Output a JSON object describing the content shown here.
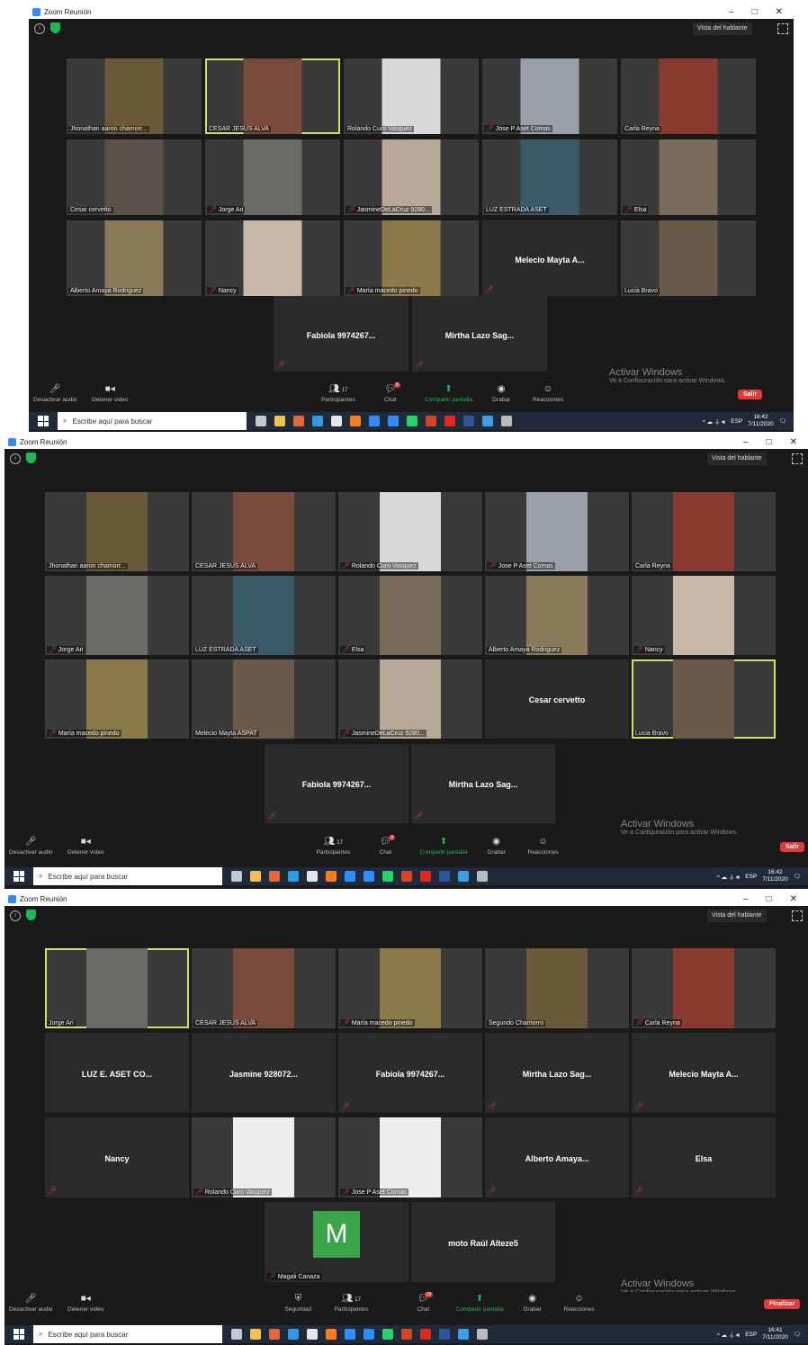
{
  "window": {
    "title": "Zoom Reunión",
    "min": "–",
    "max": "□",
    "close": "✕"
  },
  "top": {
    "speaker_view": "Vista del hablante",
    "info": "i"
  },
  "controls": {
    "mute": "Desactivar audio",
    "video": "Detener video",
    "security": "Seguridad",
    "participants": "Participantes",
    "participants_count": "17",
    "chat": "Chat",
    "chat_badge_1": "6",
    "chat_badge_3": "19",
    "share": "Compartir pantalla",
    "record": "Grabar",
    "reactions": "Reacciones",
    "leave": "Salir",
    "end": "Finalizar"
  },
  "activate": {
    "line1": "Activar Windows",
    "line2": "Ve a Configuración para activar Windows."
  },
  "taskbar": {
    "search": "Escribe aquí para buscar",
    "lang": "ESP",
    "time1": "16:42",
    "time3": "16:41",
    "date": "7/11/2020"
  },
  "shot1": {
    "tiles": [
      {
        "label": "Jhonathan aaron chamorr...",
        "muted": false,
        "video": true,
        "color": "#6b5a3a"
      },
      {
        "label": "CESAR JESUS ALVA",
        "muted": false,
        "video": true,
        "color": "#7a4a3a",
        "hl": true
      },
      {
        "label": "Rolando Curo Vasquez",
        "muted": false,
        "video": true,
        "color": "#d8d8d8"
      },
      {
        "label": "Jose P Aset Comas",
        "muted": true,
        "video": true,
        "color": "#9aa0a8"
      },
      {
        "label": "Carla Reyna",
        "muted": false,
        "video": true,
        "color": "#8a3a2e"
      },
      {
        "label": "Cesar cervetto",
        "muted": false,
        "video": true,
        "color": "#5a5248"
      },
      {
        "label": "Jorge  Ari",
        "muted": true,
        "video": true,
        "color": "#6a6a66"
      },
      {
        "label": "JasmineDeLaCruz 9280...",
        "muted": true,
        "video": true,
        "color": "#b8a898"
      },
      {
        "label": "LUZ ESTRADA ASET",
        "muted": false,
        "video": true,
        "color": "#3a5a6a"
      },
      {
        "label": "Elsa",
        "muted": true,
        "video": true,
        "color": "#7a6a5a"
      },
      {
        "label": "Alberto Amaya Rodriguez",
        "muted": false,
        "video": true,
        "color": "#8a7a5a"
      },
      {
        "label": "Nancy",
        "muted": true,
        "video": true,
        "color": "#c8b8a8"
      },
      {
        "label": "María macedo pinedo",
        "muted": true,
        "video": true,
        "color": "#8a7a4a"
      },
      {
        "label": "Melecio Mayta A...",
        "muted": true,
        "video": false
      },
      {
        "label": "Lucia Bravo",
        "muted": false,
        "video": true,
        "color": "#6a5a4a"
      },
      {
        "label": "Fabiola 9974267...",
        "muted": true,
        "video": false
      },
      {
        "label": "Mirtha Lazo Sag...",
        "muted": true,
        "video": false
      }
    ]
  },
  "shot2": {
    "tiles": [
      {
        "label": "Jhonathan aaron chamorr...",
        "muted": false,
        "video": true,
        "color": "#6b5a3a"
      },
      {
        "label": "CESAR JESUS ALVA",
        "muted": false,
        "video": true,
        "color": "#7a4a3a"
      },
      {
        "label": "Rolando Curo Vasquez",
        "muted": true,
        "video": true,
        "color": "#d8d8d8"
      },
      {
        "label": "Jose P Aset Comas",
        "muted": true,
        "video": true,
        "color": "#9aa0a8"
      },
      {
        "label": "Carla Reyna",
        "muted": false,
        "video": true,
        "color": "#8a3a2e"
      },
      {
        "label": "Jorge  Ari",
        "muted": true,
        "video": true,
        "color": "#6a6a66"
      },
      {
        "label": "LUZ ESTRADA ASET",
        "muted": false,
        "video": true,
        "color": "#3a5a6a"
      },
      {
        "label": "Elsa",
        "muted": true,
        "video": true,
        "color": "#7a6a5a"
      },
      {
        "label": "Alberto Amaya Rodriguez",
        "muted": false,
        "video": true,
        "color": "#8a7a5a"
      },
      {
        "label": "Nancy",
        "muted": true,
        "video": true,
        "color": "#c8b8a8"
      },
      {
        "label": "María macedo pinedo",
        "muted": true,
        "video": true,
        "color": "#8a7a4a"
      },
      {
        "label": "Melecio Mayta ASPAT",
        "muted": false,
        "video": true,
        "color": "#6a5a4a"
      },
      {
        "label": "JasmineDeLaCruz 9280...",
        "muted": true,
        "video": true,
        "color": "#b8a898"
      },
      {
        "label": "Cesar cervetto",
        "muted": false,
        "video": false
      },
      {
        "label": "Lucia Bravo",
        "muted": false,
        "video": true,
        "color": "#6a5a4a",
        "hl": true
      },
      {
        "label": "Fabiola 9974267...",
        "muted": true,
        "video": false
      },
      {
        "label": "Mirtha Lazo Sag...",
        "muted": true,
        "video": false
      }
    ]
  },
  "shot3": {
    "tiles": [
      {
        "label": "Jorge  Ari",
        "muted": false,
        "video": true,
        "color": "#6a6a66",
        "hl": true
      },
      {
        "label": "CESAR JESUS ALVA",
        "muted": false,
        "video": true,
        "color": "#7a4a3a"
      },
      {
        "label": "María macedo pinedo",
        "muted": true,
        "video": true,
        "color": "#8a7a4a"
      },
      {
        "label": "Segundo Chamorro",
        "muted": false,
        "video": true,
        "color": "#6b5a3a"
      },
      {
        "label": "Carla Reyna",
        "muted": true,
        "video": true,
        "color": "#8a3a2e"
      },
      {
        "label": "LUZ E. ASET CO...",
        "muted": false,
        "video": false
      },
      {
        "label": "Jasmine 928072...",
        "muted": false,
        "video": false
      },
      {
        "label": "Fabiola 9974267...",
        "muted": true,
        "video": false
      },
      {
        "label": "Mirtha Lazo Sag...",
        "muted": true,
        "video": false
      },
      {
        "label": "Melecio Mayta A...",
        "muted": true,
        "video": false
      },
      {
        "label": "Nancy",
        "muted": true,
        "video": false
      },
      {
        "label": "Rolando Curo Vasquez",
        "muted": true,
        "video": true,
        "color": "#eeeeee"
      },
      {
        "label": "Jose P Aset Comas",
        "muted": true,
        "video": true,
        "color": "#eeeeee"
      },
      {
        "label": "Alberto  Amaya...",
        "muted": true,
        "video": false
      },
      {
        "label": "Elsa",
        "muted": true,
        "video": false
      },
      {
        "label": "Magali Canaza",
        "muted": true,
        "video": false,
        "avatar": "M"
      },
      {
        "label": "moto Raúl Alteze5",
        "muted": false,
        "video": false
      }
    ]
  }
}
